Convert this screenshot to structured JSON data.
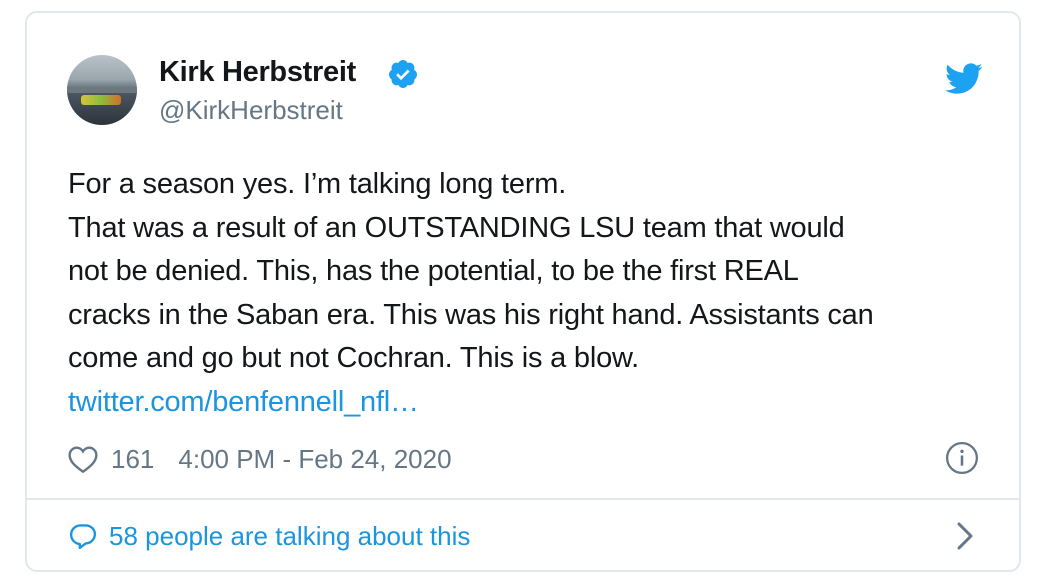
{
  "author": {
    "name": "Kirk Herbstreit",
    "handle": "@KirkHerbstreit",
    "verified": true
  },
  "tweet": {
    "text": "For a season yes. I’m talking long term.\nThat was a result of an OUTSTANDING LSU team that would\nnot be denied. This, has the potential, to be the first REAL\ncracks in the Saban era. This was his right hand. Assistants can\ncome and go but not Cochran. This is a blow.",
    "link": "twitter.com/benfennell_nfl…",
    "likes": "161",
    "timestamp": "4:00 PM - Feb 24, 2020"
  },
  "footer": {
    "conversation_label": "58 people are talking about this"
  },
  "icons": {
    "verified": "verified-badge-icon",
    "brand": "twitter-bird-icon",
    "like": "heart-icon",
    "info": "info-icon",
    "reply": "speech-bubble-icon",
    "more": "chevron-right-icon"
  },
  "colors": {
    "brand_blue": "#1da1f2",
    "link_blue": "#1b95e0",
    "text": "#14171a",
    "secondary": "#657786",
    "border": "#e1e8ed"
  }
}
